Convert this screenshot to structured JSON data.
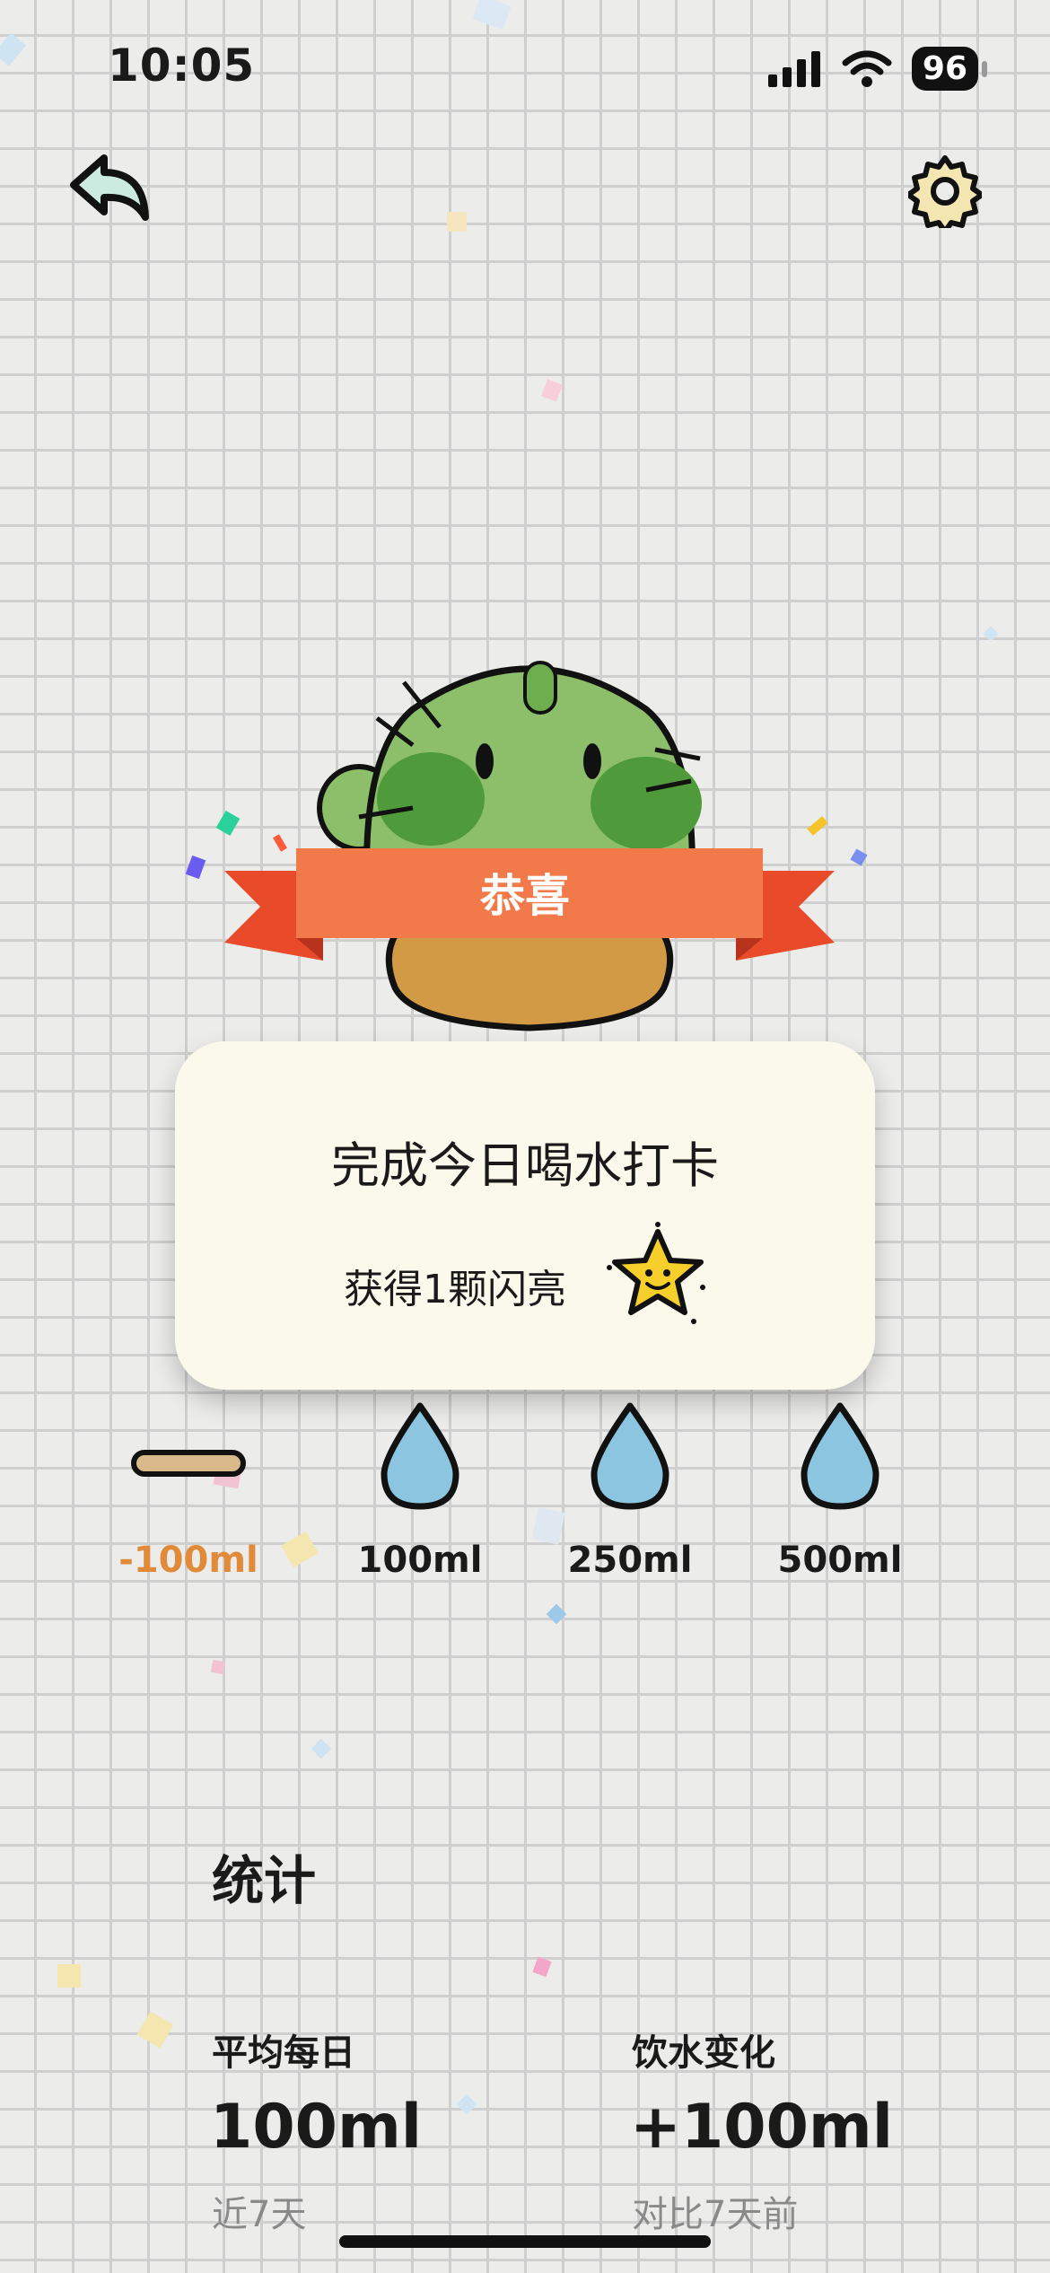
{
  "status_bar": {
    "time": "10:05",
    "battery": "96"
  },
  "header": {
    "back_icon": "back-arrow-icon",
    "settings_icon": "gear-icon"
  },
  "banner": {
    "text": "恭喜"
  },
  "card": {
    "title": "完成今日喝水打卡",
    "reward": "获得1颗闪亮"
  },
  "water_buttons": [
    {
      "label": "-100ml",
      "icon": "minus-bar-icon",
      "color": "#e08a3a"
    },
    {
      "label": "100ml",
      "icon": "water-drop-icon"
    },
    {
      "label": "250ml",
      "icon": "water-drop-icon"
    },
    {
      "label": "500ml",
      "icon": "water-drop-icon"
    }
  ],
  "stats": {
    "title": "统计",
    "average": {
      "label": "平均每日",
      "value": "100ml",
      "sub": "近7天"
    },
    "change": {
      "label": "饮水变化",
      "value": "+100ml",
      "sub": "对比7天前"
    }
  },
  "colors": {
    "banner": "#f27a4a",
    "banner_tail": "#e84a2a",
    "card": "#fbf9ec",
    "water": "#8cc5e0",
    "cactus": "#8dbf6a",
    "pot": "#d39a45",
    "star": "#f6cf2b"
  }
}
